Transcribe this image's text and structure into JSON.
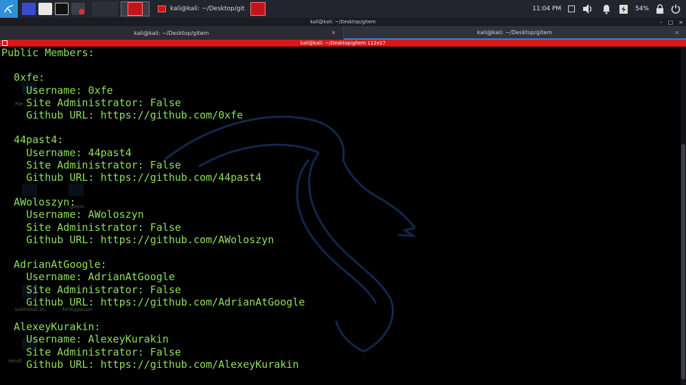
{
  "panel": {
    "task_title": "kali@kali: ~/Desktop/git",
    "clock": "11:04 PM",
    "battery": "54%"
  },
  "window": {
    "title": "kali@kali: ~/Desktop/gitem",
    "controls": [
      "–",
      "□",
      "×"
    ]
  },
  "tabs": [
    {
      "label": "kali@kali: ~/Desktop/gitem",
      "close": "×"
    },
    {
      "label": "kali@kali: ~/Desktop/gitem",
      "close": "×"
    }
  ],
  "statusbar": {
    "text": "kali@kali: ~/Desktop/gitem 112x27"
  },
  "desktop_ghosts": [
    "File",
    "gitem",
    "kaliinstall.sh",
    "403bypasser",
    "result"
  ],
  "terminal_lines": [
    "Public Members:",
    "",
    "  0xfe:",
    "    Username: 0xfe",
    "    Site Administrator: False",
    "    Github URL: https://github.com/0xfe",
    "",
    "  44past4:",
    "    Username: 44past4",
    "    Site Administrator: False",
    "    Github URL: https://github.com/44past4",
    "",
    "  AWoloszyn:",
    "    Username: AWoloszyn",
    "    Site Administrator: False",
    "    Github URL: https://github.com/AWoloszyn",
    "",
    "  AdrianAtGoogle:",
    "    Username: AdrianAtGoogle",
    "    Site Administrator: False",
    "    Github URL: https://github.com/AdrianAtGoogle",
    "",
    "  AlexeyKurakin:",
    "    Username: AlexeyKurakin",
    "    Site Administrator: False",
    "    Github URL: https://github.com/AlexeyKurakin"
  ],
  "colors": {
    "terminal_text": "#8ee05a",
    "statusbar": "#d8181a",
    "accent": "#3b7fd8"
  }
}
